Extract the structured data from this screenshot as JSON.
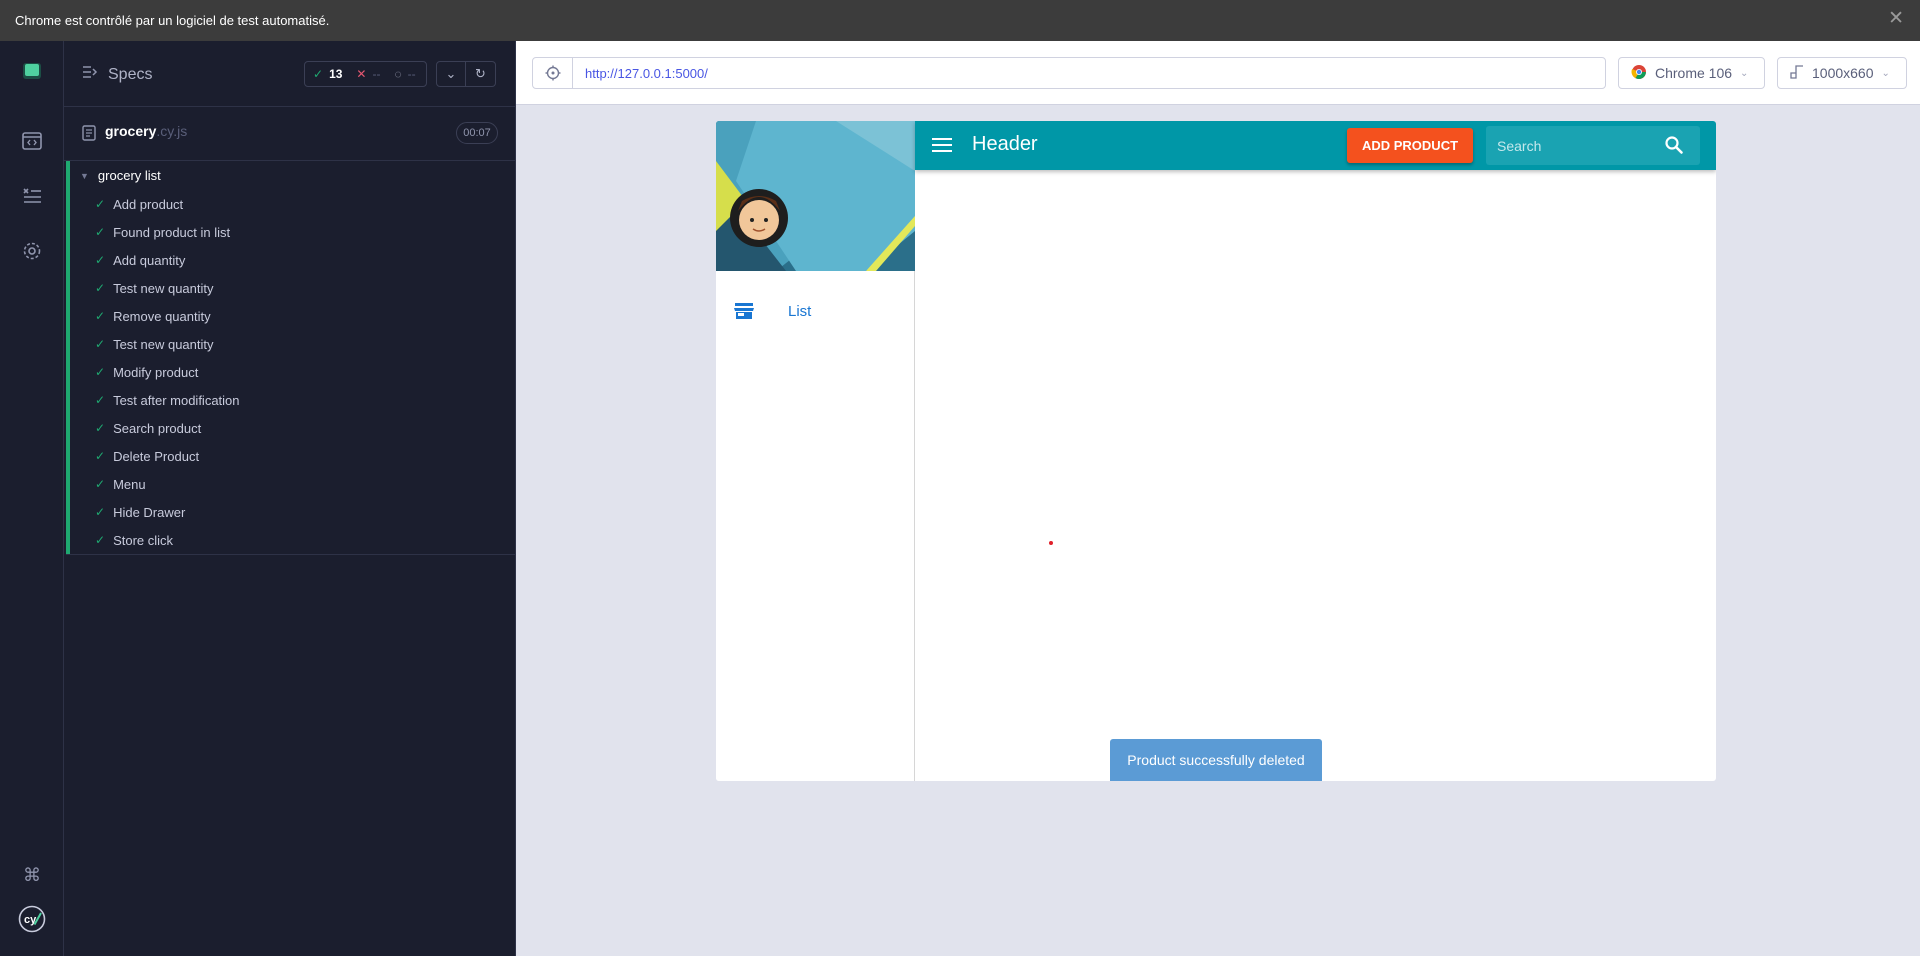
{
  "infobar": {
    "message": "Chrome est contrôlé par un logiciel de test automatisé.",
    "close_label": "✕"
  },
  "rail": {
    "icons": [
      "cypress-spec-icon",
      "browser-code-icon",
      "runs-list-icon",
      "settings-gear-icon",
      "keyboard-shortcuts-icon",
      "cypress-logo-icon"
    ]
  },
  "specs": {
    "title": "Specs",
    "stats": {
      "passed": "13",
      "failed": "--",
      "pending": "--"
    },
    "file": {
      "name": "grocery",
      "ext": ".cy.js",
      "duration": "00:07"
    },
    "suite": {
      "title": "grocery list",
      "tests": [
        "Add product",
        "Found product in list",
        "Add quantity",
        "Test new quantity",
        "Remove quantity",
        "Test new quantity",
        "Modify product",
        "Test after modification",
        "Search product",
        "Delete Product",
        "Menu",
        "Hide Drawer",
        "Store click"
      ]
    }
  },
  "preview": {
    "url": "http://127.0.0.1:5000/",
    "browser": "Chrome 106",
    "viewport": "1000x660"
  },
  "app": {
    "drawer": {
      "item_label": "List"
    },
    "header": {
      "title": "Header",
      "add_button": "ADD PRODUCT",
      "search_placeholder": "Search"
    },
    "snackbar": "Product successfully deleted"
  },
  "colors": {
    "appbar": "#0097a7",
    "add_button": "#f4511e",
    "pass": "#1fa971",
    "snackbar": "#5b9bd5"
  }
}
